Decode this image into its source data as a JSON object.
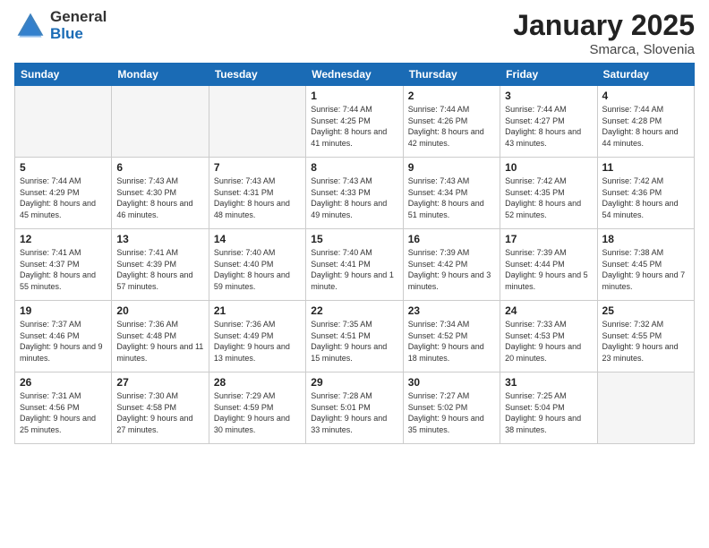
{
  "header": {
    "logo_general": "General",
    "logo_blue": "Blue",
    "title": "January 2025",
    "subtitle": "Smarca, Slovenia"
  },
  "weekdays": [
    "Sunday",
    "Monday",
    "Tuesday",
    "Wednesday",
    "Thursday",
    "Friday",
    "Saturday"
  ],
  "weeks": [
    [
      {
        "day": "",
        "info": ""
      },
      {
        "day": "",
        "info": ""
      },
      {
        "day": "",
        "info": ""
      },
      {
        "day": "1",
        "info": "Sunrise: 7:44 AM\nSunset: 4:25 PM\nDaylight: 8 hours and 41 minutes."
      },
      {
        "day": "2",
        "info": "Sunrise: 7:44 AM\nSunset: 4:26 PM\nDaylight: 8 hours and 42 minutes."
      },
      {
        "day": "3",
        "info": "Sunrise: 7:44 AM\nSunset: 4:27 PM\nDaylight: 8 hours and 43 minutes."
      },
      {
        "day": "4",
        "info": "Sunrise: 7:44 AM\nSunset: 4:28 PM\nDaylight: 8 hours and 44 minutes."
      }
    ],
    [
      {
        "day": "5",
        "info": "Sunrise: 7:44 AM\nSunset: 4:29 PM\nDaylight: 8 hours and 45 minutes."
      },
      {
        "day": "6",
        "info": "Sunrise: 7:43 AM\nSunset: 4:30 PM\nDaylight: 8 hours and 46 minutes."
      },
      {
        "day": "7",
        "info": "Sunrise: 7:43 AM\nSunset: 4:31 PM\nDaylight: 8 hours and 48 minutes."
      },
      {
        "day": "8",
        "info": "Sunrise: 7:43 AM\nSunset: 4:33 PM\nDaylight: 8 hours and 49 minutes."
      },
      {
        "day": "9",
        "info": "Sunrise: 7:43 AM\nSunset: 4:34 PM\nDaylight: 8 hours and 51 minutes."
      },
      {
        "day": "10",
        "info": "Sunrise: 7:42 AM\nSunset: 4:35 PM\nDaylight: 8 hours and 52 minutes."
      },
      {
        "day": "11",
        "info": "Sunrise: 7:42 AM\nSunset: 4:36 PM\nDaylight: 8 hours and 54 minutes."
      }
    ],
    [
      {
        "day": "12",
        "info": "Sunrise: 7:41 AM\nSunset: 4:37 PM\nDaylight: 8 hours and 55 minutes."
      },
      {
        "day": "13",
        "info": "Sunrise: 7:41 AM\nSunset: 4:39 PM\nDaylight: 8 hours and 57 minutes."
      },
      {
        "day": "14",
        "info": "Sunrise: 7:40 AM\nSunset: 4:40 PM\nDaylight: 8 hours and 59 minutes."
      },
      {
        "day": "15",
        "info": "Sunrise: 7:40 AM\nSunset: 4:41 PM\nDaylight: 9 hours and 1 minute."
      },
      {
        "day": "16",
        "info": "Sunrise: 7:39 AM\nSunset: 4:42 PM\nDaylight: 9 hours and 3 minutes."
      },
      {
        "day": "17",
        "info": "Sunrise: 7:39 AM\nSunset: 4:44 PM\nDaylight: 9 hours and 5 minutes."
      },
      {
        "day": "18",
        "info": "Sunrise: 7:38 AM\nSunset: 4:45 PM\nDaylight: 9 hours and 7 minutes."
      }
    ],
    [
      {
        "day": "19",
        "info": "Sunrise: 7:37 AM\nSunset: 4:46 PM\nDaylight: 9 hours and 9 minutes."
      },
      {
        "day": "20",
        "info": "Sunrise: 7:36 AM\nSunset: 4:48 PM\nDaylight: 9 hours and 11 minutes."
      },
      {
        "day": "21",
        "info": "Sunrise: 7:36 AM\nSunset: 4:49 PM\nDaylight: 9 hours and 13 minutes."
      },
      {
        "day": "22",
        "info": "Sunrise: 7:35 AM\nSunset: 4:51 PM\nDaylight: 9 hours and 15 minutes."
      },
      {
        "day": "23",
        "info": "Sunrise: 7:34 AM\nSunset: 4:52 PM\nDaylight: 9 hours and 18 minutes."
      },
      {
        "day": "24",
        "info": "Sunrise: 7:33 AM\nSunset: 4:53 PM\nDaylight: 9 hours and 20 minutes."
      },
      {
        "day": "25",
        "info": "Sunrise: 7:32 AM\nSunset: 4:55 PM\nDaylight: 9 hours and 23 minutes."
      }
    ],
    [
      {
        "day": "26",
        "info": "Sunrise: 7:31 AM\nSunset: 4:56 PM\nDaylight: 9 hours and 25 minutes."
      },
      {
        "day": "27",
        "info": "Sunrise: 7:30 AM\nSunset: 4:58 PM\nDaylight: 9 hours and 27 minutes."
      },
      {
        "day": "28",
        "info": "Sunrise: 7:29 AM\nSunset: 4:59 PM\nDaylight: 9 hours and 30 minutes."
      },
      {
        "day": "29",
        "info": "Sunrise: 7:28 AM\nSunset: 5:01 PM\nDaylight: 9 hours and 33 minutes."
      },
      {
        "day": "30",
        "info": "Sunrise: 7:27 AM\nSunset: 5:02 PM\nDaylight: 9 hours and 35 minutes."
      },
      {
        "day": "31",
        "info": "Sunrise: 7:25 AM\nSunset: 5:04 PM\nDaylight: 9 hours and 38 minutes."
      },
      {
        "day": "",
        "info": ""
      }
    ]
  ]
}
